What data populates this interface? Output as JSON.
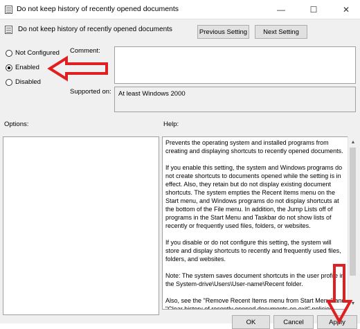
{
  "window": {
    "title": "Do not keep history of recently opened documents",
    "minimize_glyph": "—",
    "maximize_glyph": "☐",
    "close_glyph": "✕"
  },
  "header": {
    "policy_title": "Do not keep history of recently opened documents",
    "previous_label": "Previous Setting",
    "next_label": "Next Setting"
  },
  "state": {
    "options": [
      {
        "label": "Not Configured",
        "checked": false
      },
      {
        "label": "Enabled",
        "checked": true
      },
      {
        "label": "Disabled",
        "checked": false
      }
    ]
  },
  "comment": {
    "label": "Comment:",
    "value": ""
  },
  "supported": {
    "label": "Supported on:",
    "value": "At least Windows 2000"
  },
  "options_panel": {
    "label": "Options:"
  },
  "help": {
    "label": "Help:",
    "paragraphs": [
      "Prevents the operating system and installed programs from creating and displaying shortcuts to recently opened documents.",
      "If you enable this setting, the system and Windows programs do not create shortcuts to documents opened while the setting is in effect. Also, they retain but do not display existing document shortcuts. The system empties the Recent Items menu on the Start menu, and Windows programs do not display shortcuts at the bottom of the File menu. In addition, the Jump Lists off of programs in the Start Menu and Taskbar do not show lists of recently or frequently used files, folders, or websites.",
      "If you disable or do not configure this setting, the system will store and display shortcuts to recently and frequently used files, folders, and websites.",
      "Note: The system saves document shortcuts in the user profile in the System-drive\\Users\\User-name\\Recent folder.",
      "Also, see the \"Remove Recent Items menu from Start Menu\" and \"Clear history of recently opened documents on exit\" policies"
    ]
  },
  "footer": {
    "ok_label": "OK",
    "cancel_label": "Cancel",
    "apply_label": "Apply"
  },
  "annotation_color": "#e02020"
}
